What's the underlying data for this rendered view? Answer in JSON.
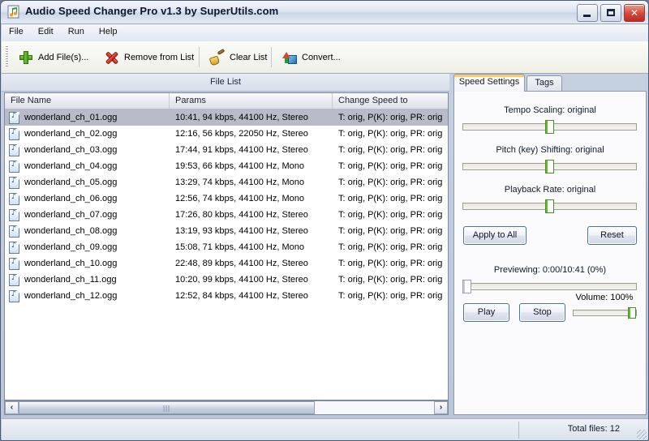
{
  "window": {
    "title": "Audio Speed Changer Pro v1.3 by SuperUtils.com",
    "icon": "music-note-icon",
    "controls": {
      "minimize": "minimize-icon",
      "maximize": "maximize-icon",
      "close": "close-icon"
    }
  },
  "menu": {
    "items": [
      "File",
      "Edit",
      "Run",
      "Help"
    ]
  },
  "toolbar": {
    "buttons": [
      {
        "label": "Add File(s)...",
        "icon": "plus-icon"
      },
      {
        "label": "Remove from List",
        "icon": "x-icon"
      },
      {
        "label": "Clear List",
        "icon": "broom-icon"
      },
      {
        "label": "Convert...",
        "icon": "convert-icon"
      }
    ]
  },
  "file_list": {
    "caption": "File List",
    "columns": [
      "File Name",
      "Params",
      "Change Speed to"
    ],
    "rows": [
      {
        "name": "wonderland_ch_01.ogg",
        "params": "10:41, 94 kbps, 44100 Hz, Stereo",
        "speed": "T: orig, P(K): orig, PR: orig",
        "selected": true
      },
      {
        "name": "wonderland_ch_02.ogg",
        "params": "12:16, 56 kbps, 22050 Hz, Stereo",
        "speed": "T: orig, P(K): orig, PR: orig",
        "selected": false
      },
      {
        "name": "wonderland_ch_03.ogg",
        "params": "17:44, 91 kbps, 44100 Hz, Stereo",
        "speed": "T: orig, P(K): orig, PR: orig",
        "selected": false
      },
      {
        "name": "wonderland_ch_04.ogg",
        "params": "19:53, 66 kbps, 44100 Hz, Mono",
        "speed": "T: orig, P(K): orig, PR: orig",
        "selected": false
      },
      {
        "name": "wonderland_ch_05.ogg",
        "params": "13:29, 74 kbps, 44100 Hz, Mono",
        "speed": "T: orig, P(K): orig, PR: orig",
        "selected": false
      },
      {
        "name": "wonderland_ch_06.ogg",
        "params": "12:56, 74 kbps, 44100 Hz, Mono",
        "speed": "T: orig, P(K): orig, PR: orig",
        "selected": false
      },
      {
        "name": "wonderland_ch_07.ogg",
        "params": "17:26, 80 kbps, 44100 Hz, Stereo",
        "speed": "T: orig, P(K): orig, PR: orig",
        "selected": false
      },
      {
        "name": "wonderland_ch_08.ogg",
        "params": "13:19, 93 kbps, 44100 Hz, Stereo",
        "speed": "T: orig, P(K): orig, PR: orig",
        "selected": false
      },
      {
        "name": "wonderland_ch_09.ogg",
        "params": "15:08, 71 kbps, 44100 Hz, Mono",
        "speed": "T: orig, P(K): orig, PR: orig",
        "selected": false
      },
      {
        "name": "wonderland_ch_10.ogg",
        "params": "22:48, 89 kbps, 44100 Hz, Stereo",
        "speed": "T: orig, P(K): orig, PR: orig",
        "selected": false
      },
      {
        "name": "wonderland_ch_11.ogg",
        "params": "10:20, 99 kbps, 44100 Hz, Stereo",
        "speed": "T: orig, P(K): orig, PR: orig",
        "selected": false
      },
      {
        "name": "wonderland_ch_12.ogg",
        "params": "12:52, 84 kbps, 44100 Hz, Stereo",
        "speed": "T: orig, P(K): orig, PR: orig",
        "selected": false
      }
    ],
    "scrollbar": {
      "left_arrow": "‹",
      "right_arrow": "›"
    }
  },
  "settings": {
    "tabs": [
      {
        "label": "Speed Settings",
        "active": true
      },
      {
        "label": "Tags",
        "active": false
      }
    ],
    "sliders": [
      {
        "label": "Tempo Scaling: original",
        "value_pct": 50
      },
      {
        "label": "Pitch (key) Shifting: original",
        "value_pct": 50
      },
      {
        "label": "Playback Rate: original",
        "value_pct": 50
      }
    ],
    "apply_label": "Apply to All",
    "reset_label": "Reset",
    "preview_label": "Previewing: 0:00/10:41 (0%)",
    "preview_pct": 0,
    "play_label": "Play",
    "stop_label": "Stop",
    "volume_label": "Volume: 100%",
    "volume_pct": 100
  },
  "status": {
    "total_files": "Total files: 12"
  },
  "colors": {
    "accent": "#ffc96a",
    "slider_green": "#5fbd2b",
    "selection": "#b9bcc8",
    "close_red": "#d4453a"
  }
}
